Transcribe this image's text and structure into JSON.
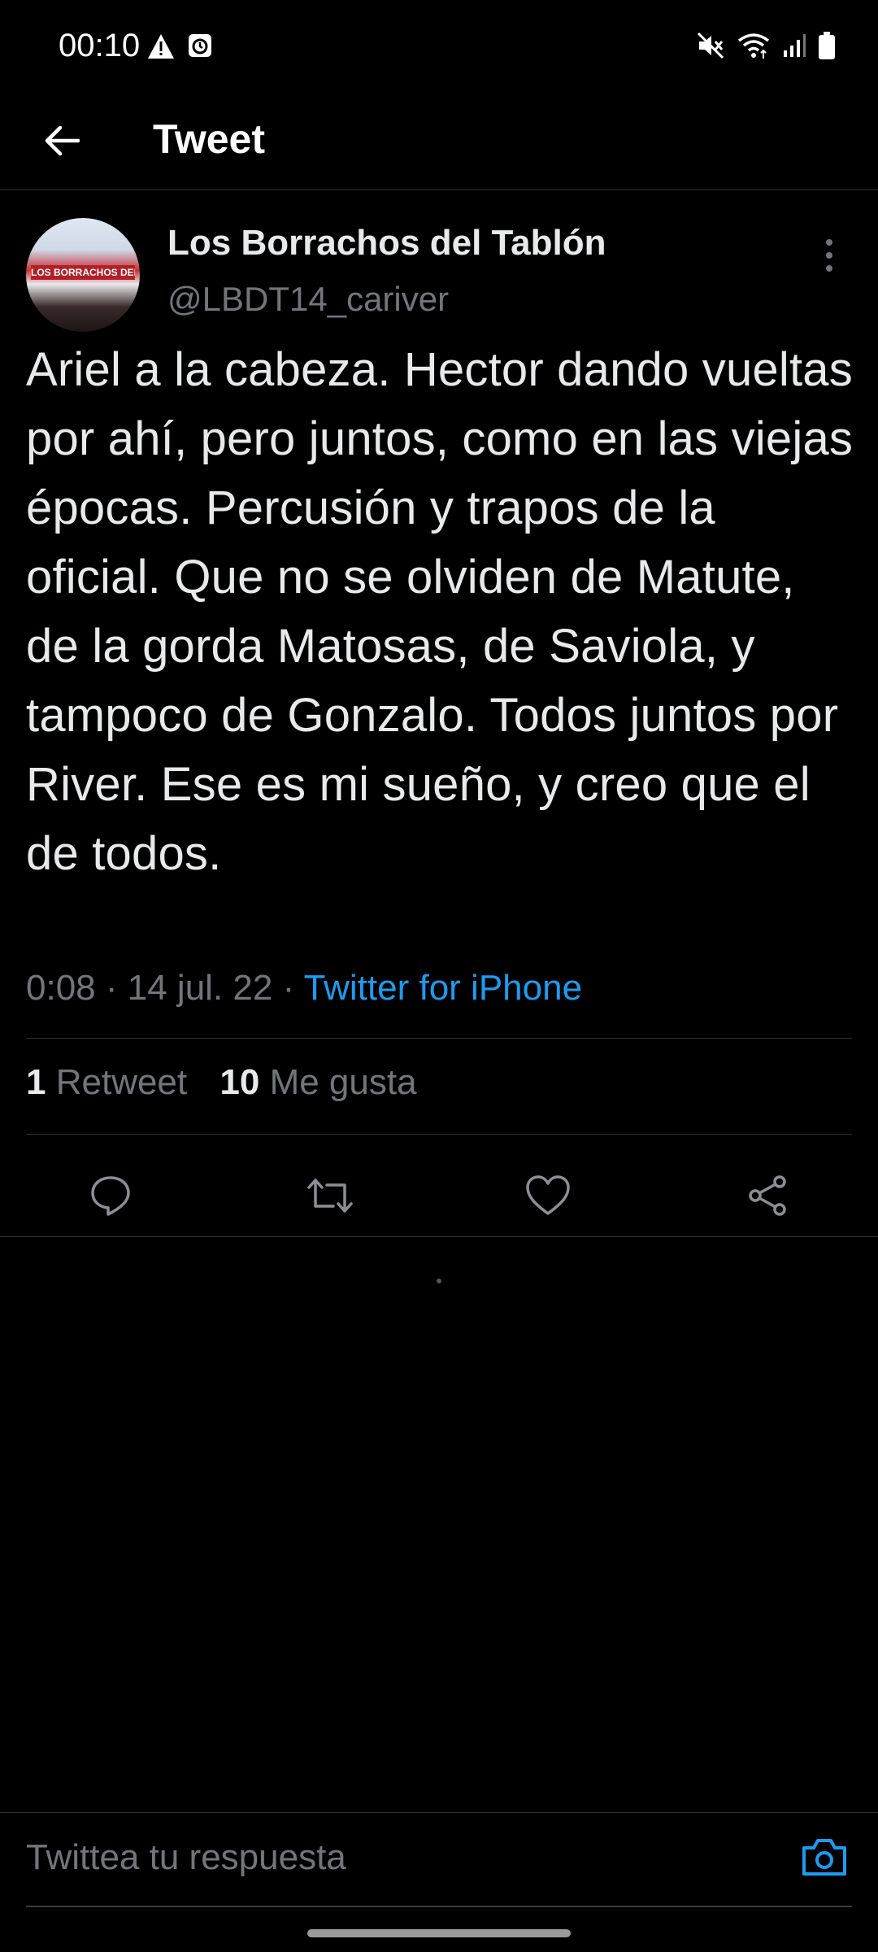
{
  "status_bar": {
    "time": "00:10",
    "left_icons": [
      "warning-icon",
      "alarm-app-icon"
    ],
    "right_icons": [
      "mute-icon",
      "wifi-icon",
      "signal-icon",
      "battery-icon"
    ]
  },
  "header": {
    "back_icon": "arrow-left-icon",
    "title": "Tweet"
  },
  "tweet": {
    "author": {
      "name": "Los Borrachos del Tablón",
      "handle": "@LBDT14_cariver",
      "avatar_banner_text": "LOS BORRACHOS DEL TABLÓN"
    },
    "text": "Ariel a la cabeza. Hector dando vueltas por ahí, pero juntos, como en las viejas épocas. Percusión y trapos de la oficial. Que no se olviden de Matute, de la gorda Matosas, de Saviola, y tampoco de Gonzalo. Todos juntos por River. Ese es mi sueño, y creo que el de todos.",
    "time": "0:08",
    "separator": "·",
    "date": "14 jul. 22",
    "source": "Twitter for iPhone",
    "stats": {
      "retweets_count": "1",
      "retweets_label": "Retweet",
      "likes_count": "10",
      "likes_label": "Me gusta"
    },
    "actions": [
      "reply-icon",
      "retweet-icon",
      "like-icon",
      "share-icon"
    ]
  },
  "reply": {
    "placeholder": "Twittea tu respuesta",
    "camera_icon": "camera-icon"
  },
  "colors": {
    "background": "#000000",
    "text_primary": "#e7e9ea",
    "text_secondary": "#71767b",
    "accent": "#1d9bf0",
    "divider": "#2f3336"
  }
}
